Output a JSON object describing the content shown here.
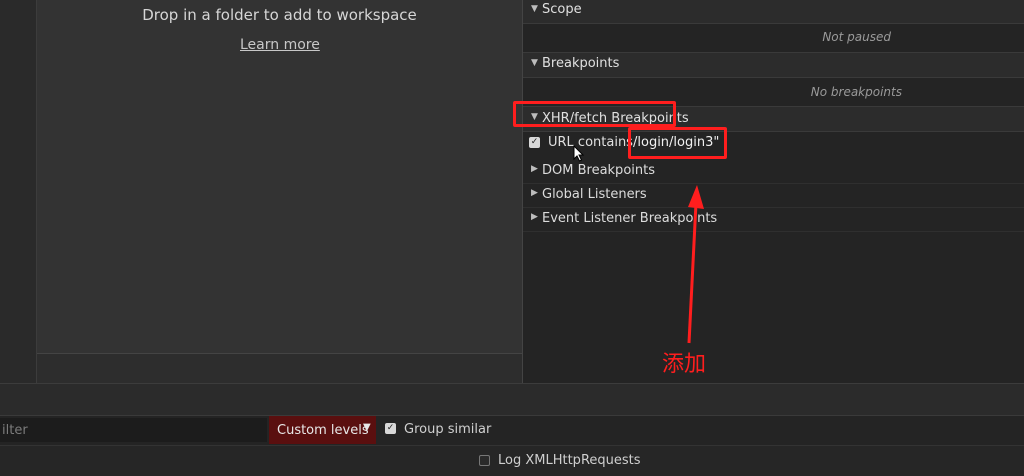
{
  "workspace": {
    "drop_text": "Drop in a folder to add to workspace",
    "learn_more": "Learn more"
  },
  "debugger": {
    "scope": {
      "label": "Scope",
      "message": "Not paused"
    },
    "breakpoints": {
      "label": "Breakpoints",
      "message": "No breakpoints"
    },
    "xhr": {
      "label": "XHR/fetch Breakpoints",
      "entry": {
        "label": "URL contains",
        "value": "/login/login3\""
      }
    },
    "collapsed_sections": [
      "DOM Breakpoints",
      "Global Listeners",
      "Event Listener Breakpoints"
    ]
  },
  "console": {
    "filter_placeholder": "ilter",
    "levels_label": "Custom levels",
    "group_similar": "Group similar",
    "log_xhr": "Log XMLHttpRequests"
  },
  "annotation": {
    "text": "添加",
    "color": "#ff1e1e"
  },
  "icons": {
    "expanded": "triangle-down",
    "collapsed": "triangle-right",
    "checkbox": "check"
  }
}
